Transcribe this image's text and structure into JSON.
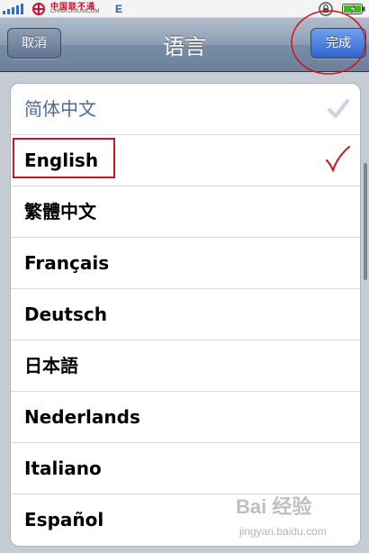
{
  "status_bar": {
    "carrier_cn": "中国联不通",
    "carrier_en": "CHINA DISUNICOM",
    "network": "E"
  },
  "nav": {
    "cancel_label": "取消",
    "title": "语言",
    "done_label": "完成"
  },
  "languages": [
    {
      "label": "简体中文",
      "checked": true
    },
    {
      "label": "English",
      "checked": false
    },
    {
      "label": "繁體中文",
      "checked": false
    },
    {
      "label": "Français",
      "checked": false
    },
    {
      "label": "Deutsch",
      "checked": false
    },
    {
      "label": "日本語",
      "checked": false
    },
    {
      "label": "Nederlands",
      "checked": false
    },
    {
      "label": "Italiano",
      "checked": false
    },
    {
      "label": "Español",
      "checked": false
    }
  ],
  "watermark": {
    "logo": "Bai 经验",
    "url": "jingyan.baidu.com"
  },
  "colors": {
    "nav_gradient_top": "#b2bdcb",
    "nav_gradient_bottom": "#6d809a",
    "done_button": "#2f66d0",
    "selected_text": "#4c6aa0",
    "annotation_red": "#d0141f"
  }
}
